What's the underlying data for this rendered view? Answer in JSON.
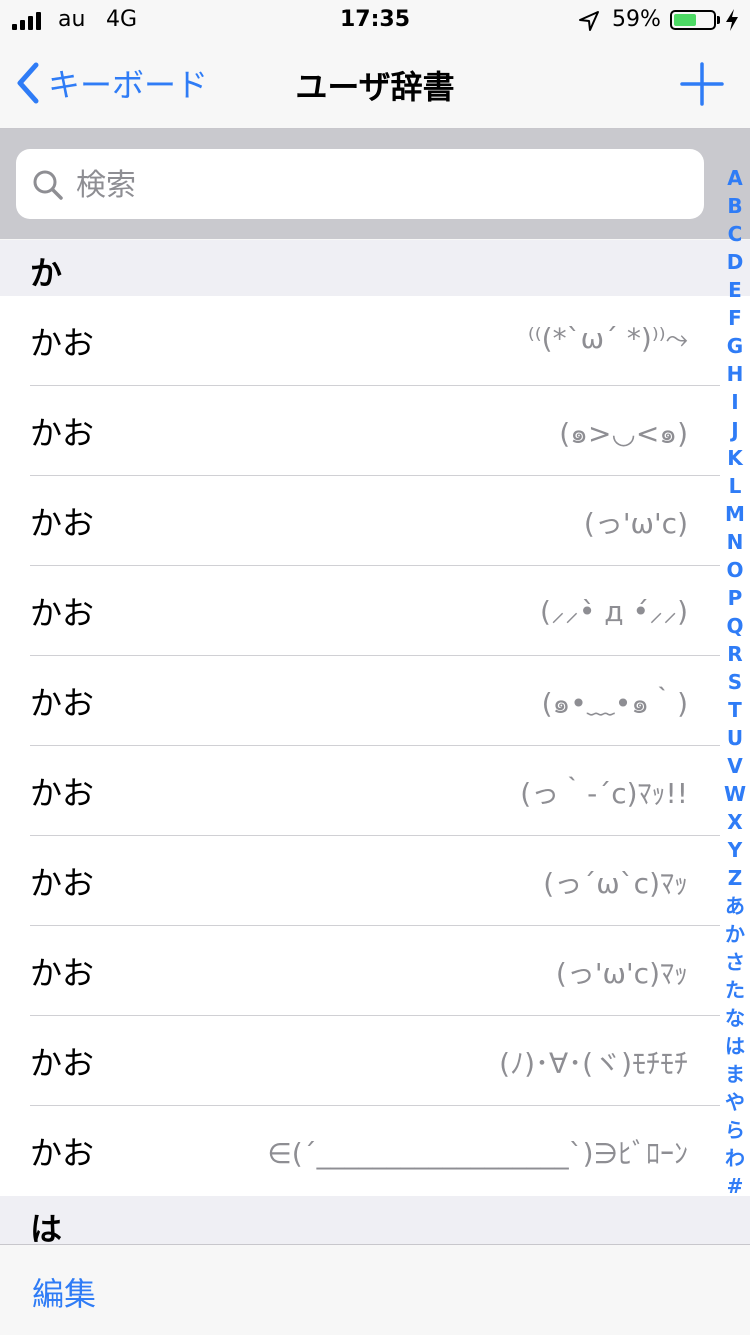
{
  "status_bar": {
    "carrier": "au",
    "network": "4G",
    "time": "17:35",
    "battery_percent": "59%",
    "battery_level": 0.59,
    "battery_color": "#4cd964"
  },
  "nav": {
    "back_label": "キーボード",
    "title": "ユーザ辞書",
    "add_icon": "plus-icon",
    "accent_color": "#2f7cf6"
  },
  "search": {
    "placeholder": "検索",
    "value": ""
  },
  "sections": [
    {
      "header": "か",
      "items": [
        {
          "word": "かお",
          "reading": "⁽⁽(*`ω´ *)⁾⁾⤳"
        },
        {
          "word": "かお",
          "reading": "(๑>◡<๑)"
        },
        {
          "word": "かお",
          "reading": "(っ'ω'c)"
        },
        {
          "word": "かお",
          "reading": "(⸝⸝•̀ д •́⸝⸝)"
        },
        {
          "word": "かお",
          "reading": "(๑•﹏•๑｀)"
        },
        {
          "word": "かお",
          "reading": "(っ｀-´c)ﾏｯ!!"
        },
        {
          "word": "かお",
          "reading": "(っ´ω`c)ﾏｯ"
        },
        {
          "word": "かお",
          "reading": "(っ'ω'c)ﾏｯ"
        },
        {
          "word": "かお",
          "reading": "(ﾉ)･∀･(ヾ)ﾓﾁﾓﾁ"
        },
        {
          "word": "かお",
          "reading": "∈(´__________________`)∋ﾋﾞﾛｰﾝ"
        }
      ]
    },
    {
      "header": "は",
      "items": []
    }
  ],
  "index": [
    "A",
    "B",
    "C",
    "D",
    "E",
    "F",
    "G",
    "H",
    "I",
    "J",
    "K",
    "L",
    "M",
    "N",
    "O",
    "P",
    "Q",
    "R",
    "S",
    "T",
    "U",
    "V",
    "W",
    "X",
    "Y",
    "Z",
    "あ",
    "か",
    "さ",
    "た",
    "な",
    "は",
    "ま",
    "や",
    "ら",
    "わ",
    "#"
  ],
  "toolbar": {
    "edit_label": "編集"
  }
}
